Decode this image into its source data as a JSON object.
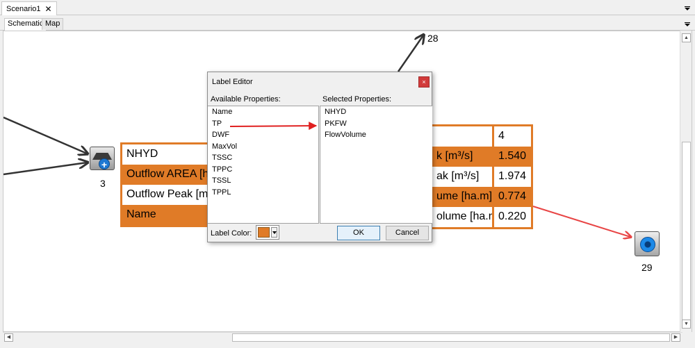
{
  "document_tab": {
    "label": "Scenario1",
    "close_glyph": "✕"
  },
  "view_tabs": [
    {
      "label": "Schematic",
      "active": true
    },
    {
      "label": "Map",
      "active": false
    }
  ],
  "nodes": {
    "storage": {
      "id": "3",
      "icon": "storage-plus-icon"
    },
    "outfall": {
      "id": "29",
      "icon": "outfall-icon"
    },
    "upstream_link_target": {
      "id": "28"
    }
  },
  "left_label_table": {
    "rows": [
      {
        "label": "NHYD",
        "style": "white"
      },
      {
        "label": "Outflow AREA [h",
        "style": "orange"
      },
      {
        "label": "Outflow Peak [m",
        "style": "white"
      },
      {
        "label": "Name",
        "style": "orange"
      }
    ]
  },
  "right_label_table": {
    "rows": [
      {
        "label": "",
        "value": "4",
        "style": "white"
      },
      {
        "label": "k [m³/s]",
        "value": "1.540",
        "style": "orange"
      },
      {
        "label": "ak [m³/s]",
        "value": "1.974",
        "style": "white"
      },
      {
        "label": "ume [ha.m]",
        "value": "0.774",
        "style": "orange"
      },
      {
        "label": "olume [ha.m]",
        "value": "0.220",
        "style": "white"
      }
    ]
  },
  "dialog": {
    "title": "Label Editor",
    "close_glyph": "×",
    "available_heading": "Available Properties:",
    "selected_heading": "Selected Properties:",
    "available": [
      "Name",
      "TP",
      "DWF",
      "MaxVol",
      "TSSC",
      "TPPC",
      "TSSL",
      "TPPL"
    ],
    "selected": [
      "NHYD",
      "PKFW",
      "FlowVolume"
    ],
    "label_color_text": "Label Color:",
    "label_color": "#e07b27",
    "ok_label": "OK",
    "cancel_label": "Cancel"
  },
  "colors": {
    "accent": "#e07b27",
    "link": "#333333",
    "highlight_link": "#e84545"
  }
}
